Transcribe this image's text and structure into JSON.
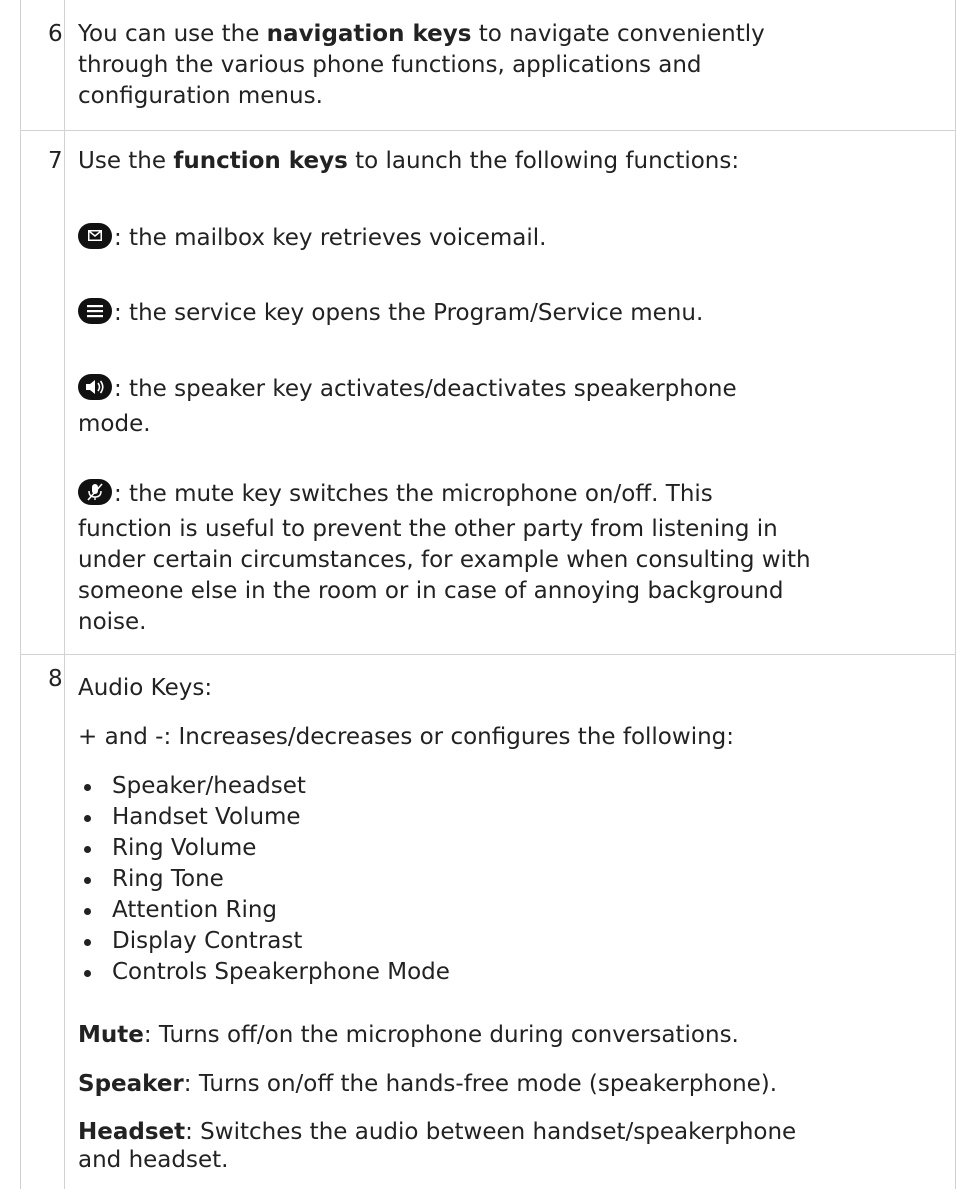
{
  "rows": [
    {
      "number": "6",
      "line1_pre": "You can use the ",
      "line1_bold": "navigation keys",
      "line1_post": " to navigate conveniently",
      "line2": "through the various phone functions, applications and",
      "line3": "configuration menus."
    },
    {
      "number": "7",
      "intro_pre": "Use the ",
      "intro_bold": "function keys",
      "intro_post": " to launch the following functions:",
      "items": [
        {
          "icon": "mailbox-icon",
          "lines": [
            ": the mailbox key retrieves voicemail."
          ]
        },
        {
          "icon": "service-menu-icon",
          "lines": [
            ": the service key opens the Program/Service menu."
          ]
        },
        {
          "icon": "speaker-icon",
          "lines": [
            ": the speaker key activates/deactivates speakerphone",
            "mode."
          ]
        },
        {
          "icon": "mute-microphone-icon",
          "lines": [
            ": the mute key switches the microphone on/off. This",
            "function is useful to prevent the other party from listening in",
            "under certain circumstances, for example when consulting with",
            "someone else in the room or in case of annoying background",
            "noise."
          ]
        }
      ]
    },
    {
      "number": "8",
      "heading": "Audio Keys:",
      "plusminus": "+ and -: Increases/decreases or configures the following:",
      "bullets": [
        "Speaker/headset",
        "Handset Volume",
        "Ring Volume",
        "Ring Tone",
        "Attention Ring",
        "Display Contrast",
        "Controls Speakerphone Mode"
      ],
      "mute_label": "Mute",
      "mute_text": ": Turns off/on the microphone during conversations.",
      "speaker_label": "Speaker",
      "speaker_text": ": Turns on/off the hands-free mode (speakerphone).",
      "headset_label": "Headset",
      "headset_line1": ": Switches the audio between handset/speakerphone",
      "headset_line2": "and headset."
    }
  ]
}
